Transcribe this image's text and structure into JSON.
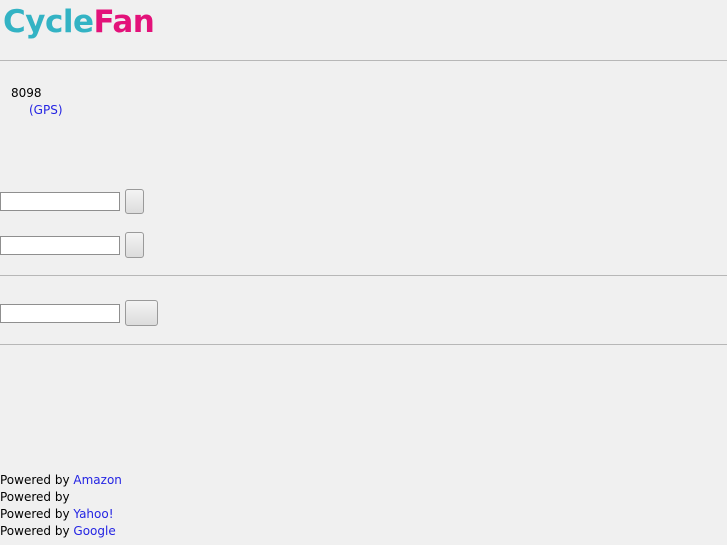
{
  "header": {
    "logo_part1": "Cycle",
    "logo_part2": "Fan",
    "logo_color1": "#33b3c4",
    "logo_color2": "#e3127a"
  },
  "info": {
    "count": "8098",
    "gps_link": "(GPS)"
  },
  "forms": [
    {
      "input_value": "",
      "button_label": ""
    },
    {
      "input_value": "",
      "button_label": ""
    },
    {
      "input_value": "",
      "button_label": ""
    }
  ],
  "footer": {
    "powered_prefix": "Powered by",
    "providers": [
      "Amazon",
      "",
      "Yahoo!",
      "Google"
    ]
  },
  "colors": {
    "link": "#2424e3",
    "background": "#f0f0f0",
    "rule": "#b7b7b7"
  }
}
